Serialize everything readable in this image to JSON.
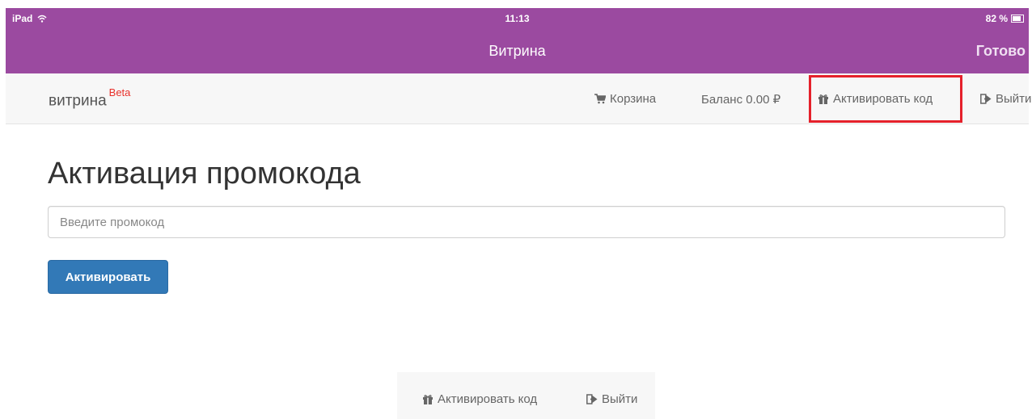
{
  "status_bar": {
    "device": "iPad",
    "time": "11:13",
    "battery": "82 %"
  },
  "browser_bar": {
    "title": "Витрина",
    "done": "Готово"
  },
  "navbar": {
    "brand": "витрина",
    "brand_badge": "Beta",
    "cart": "Корзина",
    "balance": "Баланс 0.00 ₽",
    "activate": "Активировать код",
    "logout": "Выйти"
  },
  "main": {
    "title": "Активация промокода",
    "promo_placeholder": "Введите промокод",
    "promo_value": "",
    "activate_button": "Активировать"
  },
  "bottom_nav": {
    "activate": "Активировать код",
    "logout": "Выйти"
  },
  "icons": {
    "cart": "cart-icon",
    "gift": "gift-icon",
    "logout": "logout-icon",
    "wifi": "wifi-icon",
    "battery": "battery-icon"
  },
  "colors": {
    "ios_bar": "#9b4aa0",
    "primary_button": "#3279b7",
    "highlight": "#e5212b",
    "beta": "#e8302a"
  }
}
